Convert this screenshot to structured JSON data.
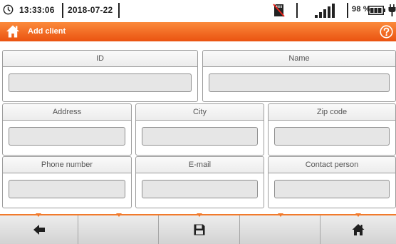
{
  "status_bar": {
    "time": "13:33:06",
    "date": "2018-07-22",
    "battery_percent": "98 %",
    "icons": [
      "clock-icon",
      "sd-card-disabled-icon",
      "signal-strength-icon",
      "battery-icon",
      "plug-icon"
    ]
  },
  "title_bar": {
    "title": "Add client",
    "icons": [
      "home-icon",
      "help-icon"
    ]
  },
  "form": {
    "fields": [
      {
        "label": "ID",
        "value": ""
      },
      {
        "label": "Name",
        "value": ""
      },
      {
        "label": "Address",
        "value": ""
      },
      {
        "label": "City",
        "value": ""
      },
      {
        "label": "Zip code",
        "value": ""
      },
      {
        "label": "Phone number",
        "value": ""
      },
      {
        "label": "E-mail",
        "value": ""
      },
      {
        "label": "Contact person",
        "value": ""
      }
    ]
  },
  "toolbar": {
    "buttons": [
      {
        "icon": "back-arrow-icon"
      },
      {
        "icon": ""
      },
      {
        "icon": "save-icon"
      },
      {
        "icon": ""
      },
      {
        "icon": "home-icon"
      }
    ]
  },
  "colors": {
    "accent": "#f26a1b",
    "title_text": "#ffffff",
    "input_fill": "#e6e6e6",
    "toolbar_fill": "#dcdcdc"
  }
}
